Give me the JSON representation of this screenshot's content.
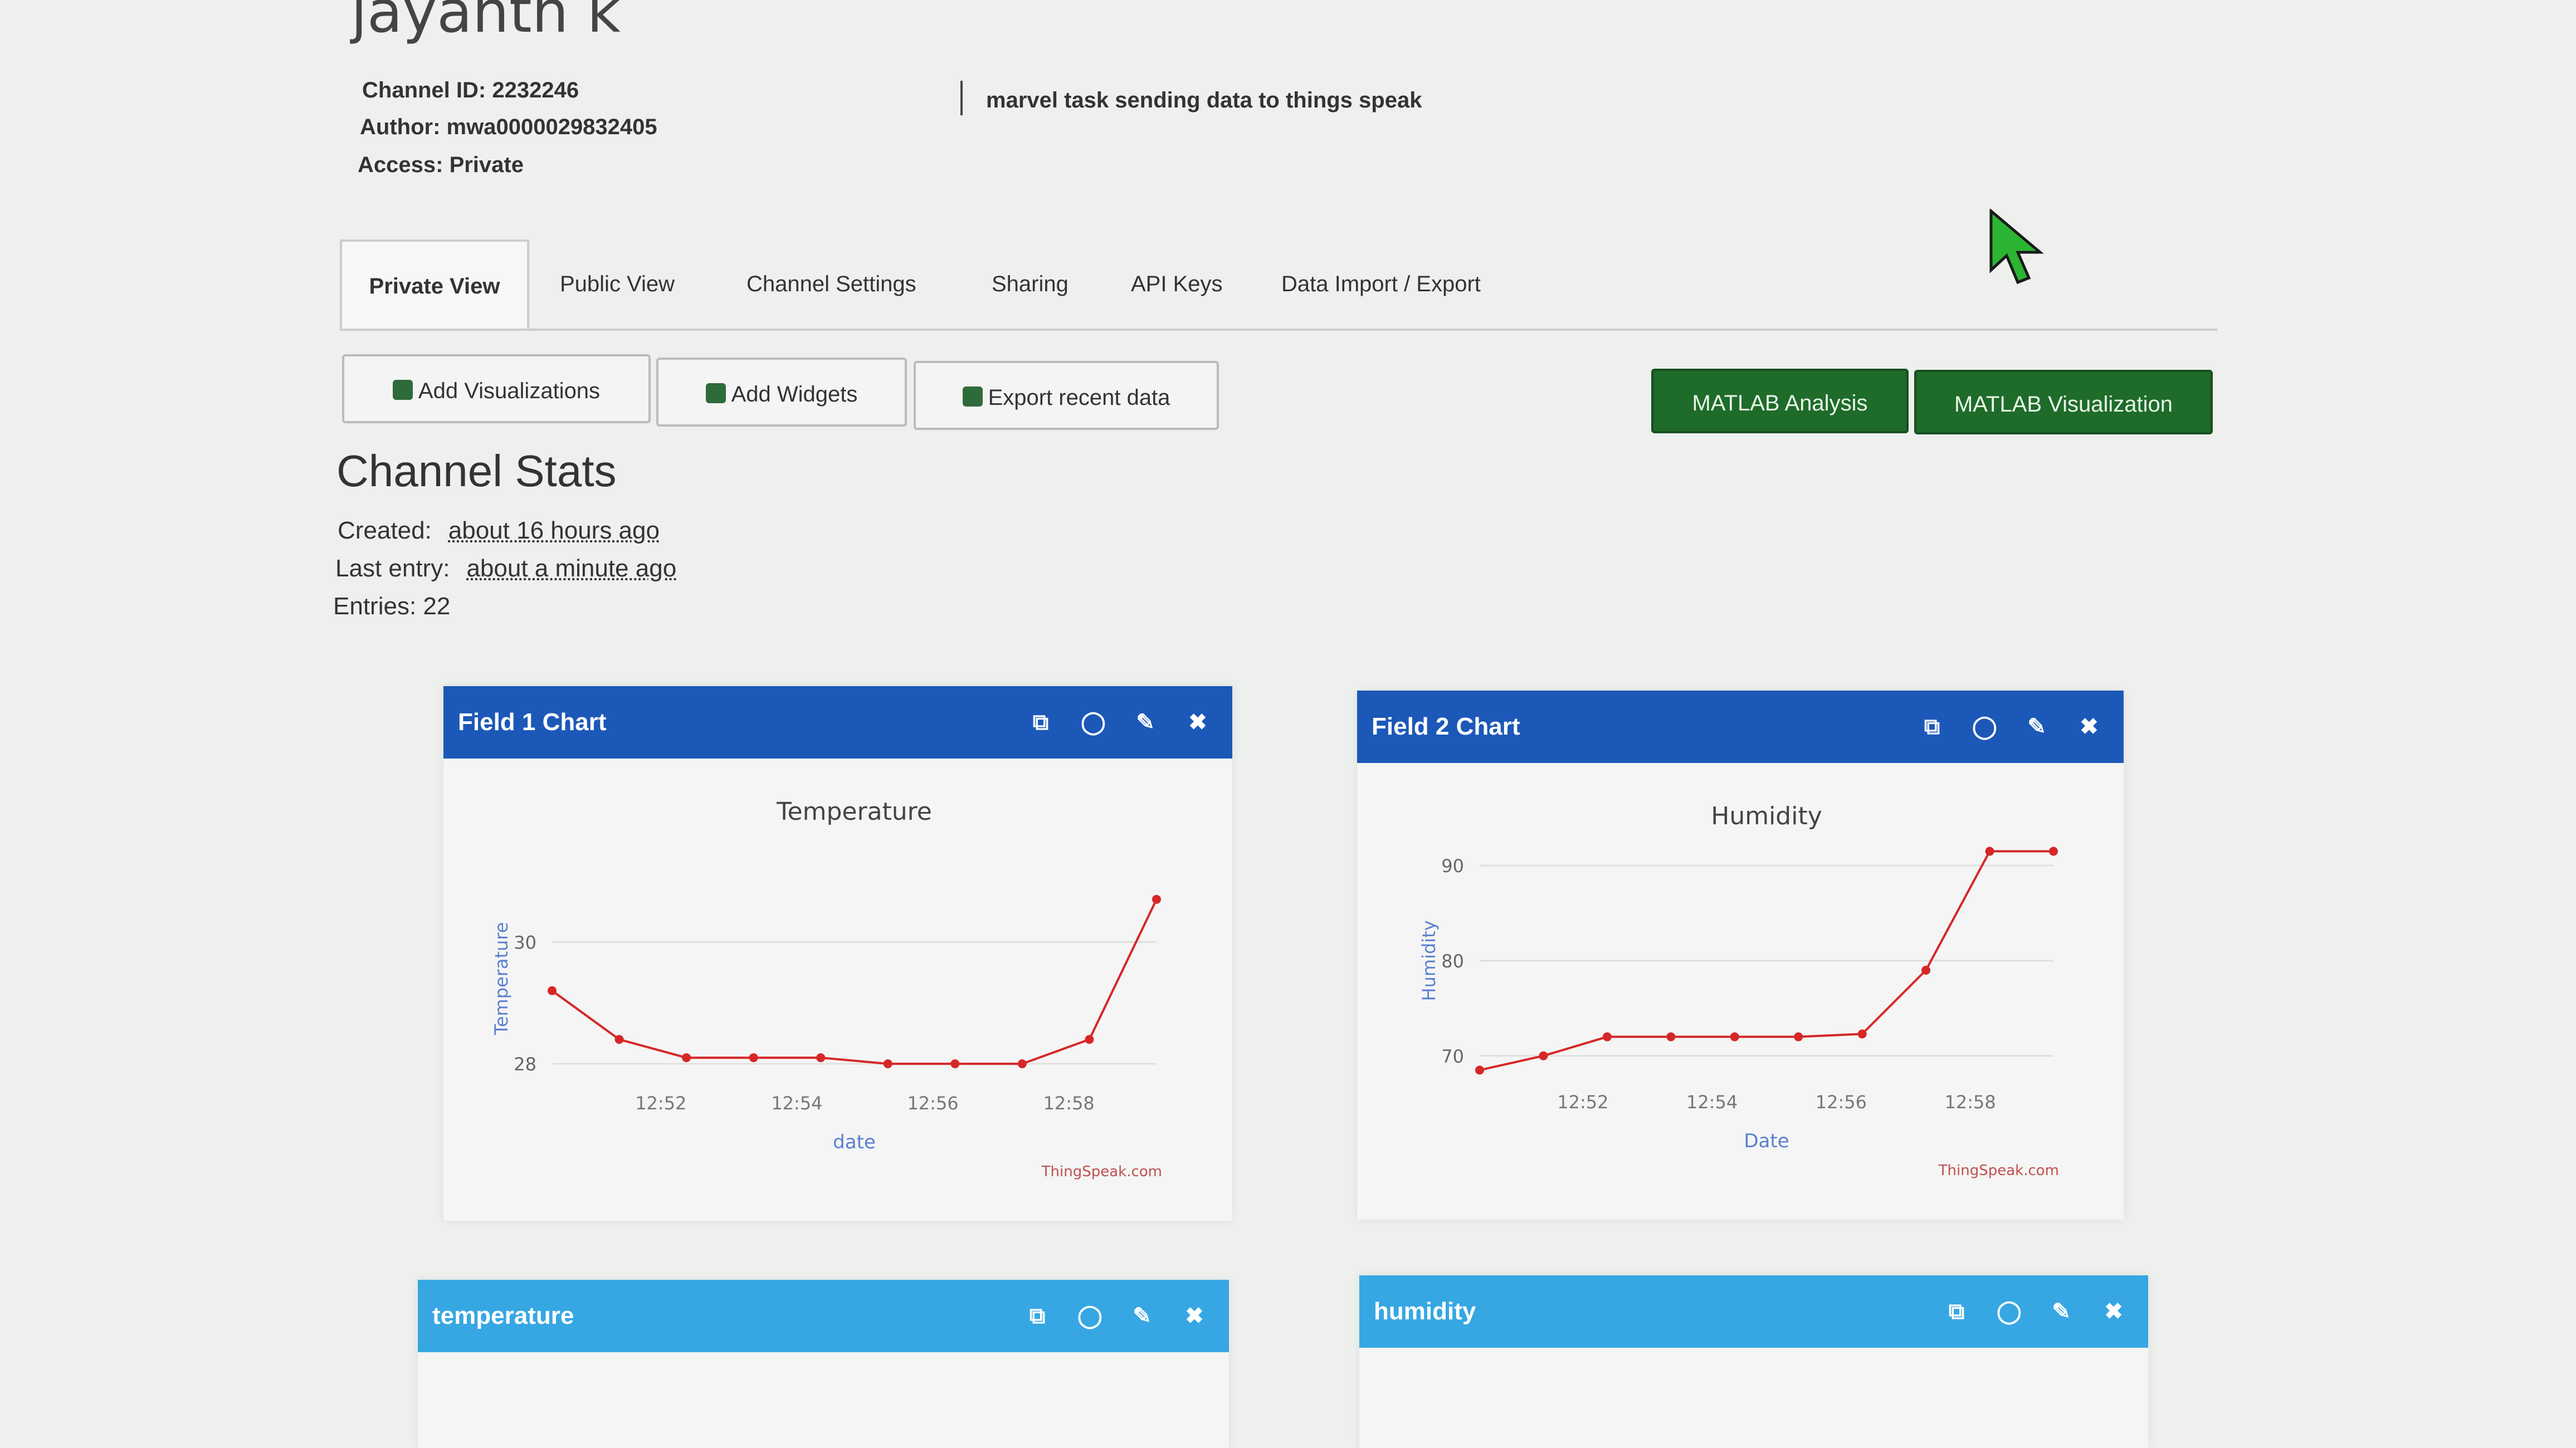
{
  "channel": {
    "name": "jayanth k",
    "id_label": "Channel ID:",
    "id_value": "2232246",
    "author_label": "Author:",
    "author_value": "mwa0000029832405",
    "access_label": "Access:",
    "access_value": "Private",
    "description": "marvel task sending data to things speak"
  },
  "tabs": [
    "Private View",
    "Public View",
    "Channel Settings",
    "Sharing",
    "API Keys",
    "Data Import / Export"
  ],
  "buttons": {
    "add_visualizations": "Add Visualizations",
    "add_widgets": "Add Widgets",
    "export_recent": "Export recent data",
    "matlab_analysis": "MATLAB Analysis",
    "matlab_visualization": "MATLAB Visualization"
  },
  "stats": {
    "title": "Channel Stats",
    "created_label": "Created:",
    "created_value": "about 16 hours ago",
    "last_entry_label": "Last entry:",
    "last_entry_value": "about a minute ago",
    "entries_label": "Entries:",
    "entries_value": "22"
  },
  "panels": {
    "field1": "Field 1 Chart",
    "field2": "Field 2 Chart",
    "widget1": "temperature",
    "widget2": "humidity"
  },
  "chart_data": [
    {
      "type": "line",
      "title": "Temperature",
      "xlabel": "date",
      "ylabel": "Temperature",
      "credit": "ThingSpeak.com",
      "x_ticks": [
        "12:52",
        "12:54",
        "12:56",
        "12:58"
      ],
      "y_ticks": [
        28,
        30
      ],
      "x_range": [
        0,
        9
      ],
      "ylim": [
        27.8,
        31.0
      ],
      "color": "#d62728",
      "series": [
        {
          "x": [
            0,
            1,
            2,
            3,
            4,
            5,
            6,
            7,
            8,
            9
          ],
          "y": [
            29.2,
            28.4,
            28.1,
            28.1,
            28.1,
            28.0,
            28.0,
            28.0,
            28.4,
            30.7
          ]
        }
      ]
    },
    {
      "type": "line",
      "title": "Humidity",
      "xlabel": "Date",
      "ylabel": "Humidity",
      "credit": "ThingSpeak.com",
      "x_ticks": [
        "12:52",
        "12:54",
        "12:56",
        "12:58"
      ],
      "y_ticks": [
        70,
        80,
        90
      ],
      "x_range": [
        0,
        9
      ],
      "ylim": [
        68,
        92
      ],
      "color": "#d62728",
      "series": [
        {
          "x": [
            0,
            1,
            2,
            3,
            4,
            5,
            6,
            7,
            8,
            9
          ],
          "y": [
            68.5,
            70,
            72,
            72,
            72,
            72,
            72.3,
            79,
            91.5,
            91.5
          ]
        }
      ]
    }
  ]
}
